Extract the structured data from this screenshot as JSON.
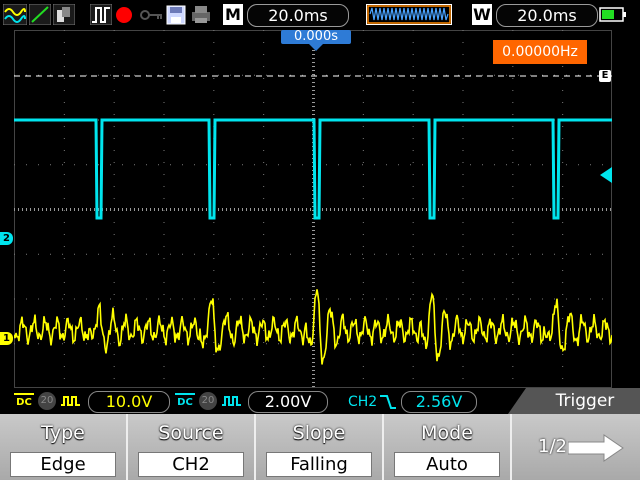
{
  "toolbar": {
    "icons": [
      "waveform-math-icon",
      "ref-waveform-icon",
      "fft-icon",
      "pulse-icon",
      "record-icon",
      "key-icon",
      "save-icon",
      "print-icon"
    ],
    "mode_label": "M",
    "timebase": "20.0ms",
    "window_label": "W",
    "window_timebase": "20.0ms"
  },
  "screen": {
    "trigger_position": "0.000s",
    "frequency": "0.00000Hz",
    "ch1_marker": "1",
    "ch2_marker": "2",
    "trigger_level_marker": "E"
  },
  "status": {
    "ch1_coupling": "DC",
    "ch1_bw": "20",
    "ch1_volts": "10.0V",
    "ch2_coupling": "DC",
    "ch2_bw": "20",
    "ch2_volts": "2.00V",
    "trigger_source": "CH2",
    "trigger_level": "2.56V",
    "menu_title": "Trigger"
  },
  "softkeys": [
    {
      "label": "Type",
      "value": "Edge"
    },
    {
      "label": "Source",
      "value": "CH2"
    },
    {
      "label": "Slope",
      "value": "Falling"
    },
    {
      "label": "Mode",
      "value": "Auto"
    }
  ],
  "page_indicator": "1/2",
  "colors": {
    "ch1": "#ffff00",
    "ch2": "#00e5ee",
    "frequency_bg": "#ff6600",
    "trigger_marker": "#2e7bd6"
  }
}
